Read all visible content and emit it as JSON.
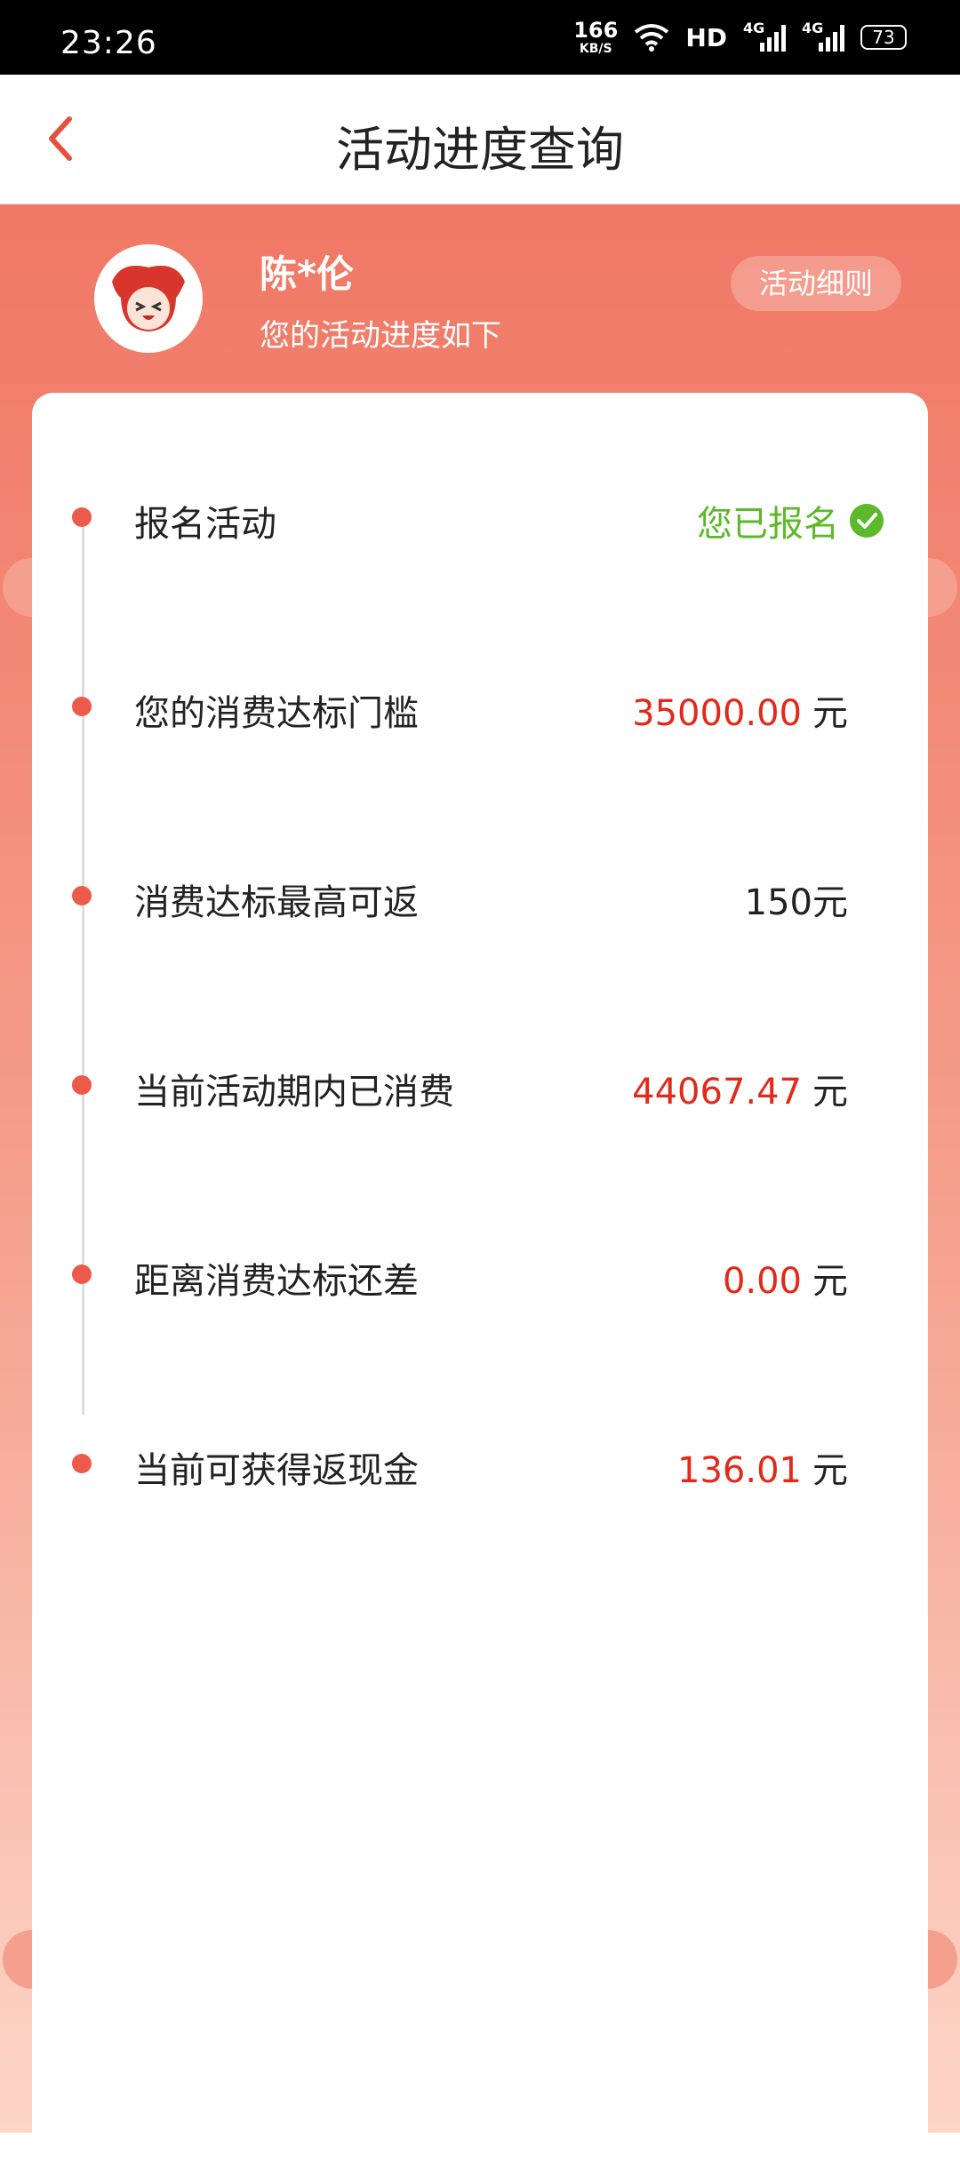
{
  "status_bar": {
    "time": "23:26",
    "net_speed": "166",
    "net_unit": "KB/S",
    "hd": "HD",
    "signal1_label": "4G",
    "signal2_label": "4G",
    "battery": "73"
  },
  "nav": {
    "back_icon": "chevron-left-icon",
    "title": "活动进度查询"
  },
  "user": {
    "name": "陈*伦",
    "subtitle": "您的活动进度如下",
    "rules_button": "活动细则"
  },
  "progress": [
    {
      "label": "报名活动",
      "status_text": "您已报名",
      "status_icon": "check-circle-icon"
    },
    {
      "label": "您的消费达标门槛",
      "value": "35000.00",
      "unit": "元",
      "highlight": true
    },
    {
      "label": "消费达标最高可返",
      "value": "150元",
      "unit": "",
      "highlight": false
    },
    {
      "label": "当前活动期内已消费",
      "value": "44067.47",
      "unit": "元",
      "highlight": true
    },
    {
      "label": "距离消费达标还差",
      "value": "0.00",
      "unit": "元",
      "highlight": true
    },
    {
      "label": "当前可获得返现金",
      "value": "136.01",
      "unit": "元",
      "highlight": true
    }
  ],
  "colors": {
    "accent_red": "#e2291a",
    "success_green": "#5bb92a",
    "header_gradient_top": "#f07865",
    "timeline_dot": "#ee5a4a"
  }
}
